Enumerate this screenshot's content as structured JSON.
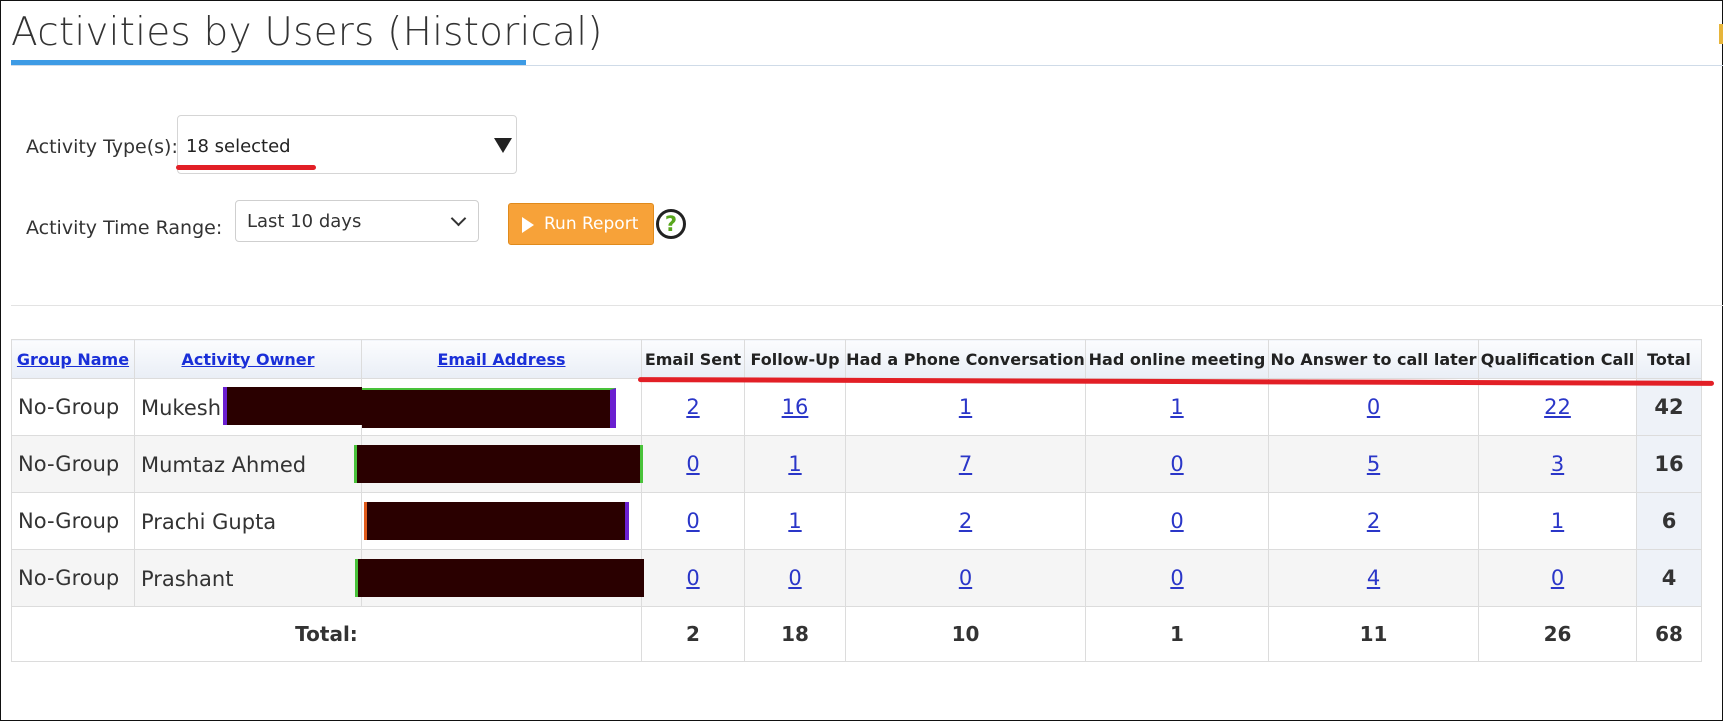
{
  "page": {
    "title": "Activities by Users (Historical)"
  },
  "filters": {
    "activity_types_label": "Activity Type(s):",
    "activity_types_value": "18 selected",
    "time_range_label": "Activity Time Range:",
    "time_range_value": "Last 10 days",
    "run_button_label": "Run Report",
    "help_glyph": "?"
  },
  "table": {
    "headers": {
      "group_name": "Group Name",
      "activity_owner": "Activity Owner",
      "email_address": "Email Address",
      "email_sent": "Email Sent",
      "follow_up": "Follow-Up",
      "phone_conversation": "Had a Phone Conversation",
      "online_meeting": "Had online meeting",
      "no_answer": "No Answer to call later",
      "qualification_call": "Qualification Call",
      "total": "Total"
    },
    "rows": [
      {
        "group": "No-Group",
        "owner": "Mukesh",
        "email_sent": "2",
        "follow_up": "16",
        "phone": "1",
        "meeting": "1",
        "no_answer": "0",
        "qualification": "22",
        "total": "42"
      },
      {
        "group": "No-Group",
        "owner": "Mumtaz Ahmed",
        "email_sent": "0",
        "follow_up": "1",
        "phone": "7",
        "meeting": "0",
        "no_answer": "5",
        "qualification": "3",
        "total": "16"
      },
      {
        "group": "No-Group",
        "owner": "Prachi Gupta",
        "email_sent": "0",
        "follow_up": "1",
        "phone": "2",
        "meeting": "0",
        "no_answer": "2",
        "qualification": "1",
        "total": "6"
      },
      {
        "group": "No-Group",
        "owner": "Prashant",
        "email_sent": "0",
        "follow_up": "0",
        "phone": "0",
        "meeting": "0",
        "no_answer": "4",
        "qualification": "0",
        "total": "4"
      }
    ],
    "footer": {
      "label": "Total:",
      "email_sent": "2",
      "follow_up": "18",
      "phone": "10",
      "meeting": "1",
      "no_answer": "11",
      "qualification": "26",
      "total": "68"
    }
  },
  "colors": {
    "accent_blue": "#3d9be5",
    "run_button": "#f7a239",
    "annotation_red": "#e21f26",
    "link_blue": "#2a36c8",
    "redaction": "#2a0000"
  }
}
